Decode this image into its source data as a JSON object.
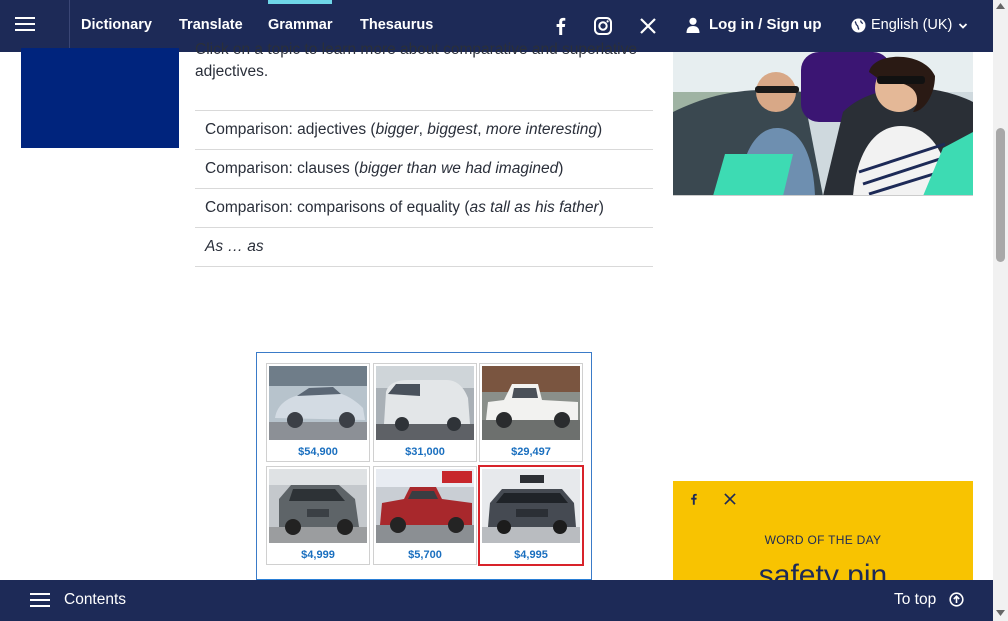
{
  "nav": {
    "items": [
      {
        "label": "Dictionary"
      },
      {
        "label": "Translate"
      },
      {
        "label": "Grammar",
        "active": true
      },
      {
        "label": "Thesaurus"
      }
    ],
    "login_label": "Log in / Sign up",
    "language_label": "English (UK)",
    "icons": [
      "menu-icon",
      "facebook-icon",
      "instagram-icon",
      "x-icon",
      "user-icon",
      "globe-icon",
      "chevron-down-icon"
    ]
  },
  "main": {
    "intro": "Click on a topic to learn more about comparative and superlative adjectives.",
    "topics": [
      {
        "prefix": "Comparison: adjectives (",
        "ex1": "bigger",
        "sep1": ", ",
        "ex2": "biggest",
        "sep2": ", ",
        "ex3": "more interesting",
        "suffix": ")"
      },
      {
        "prefix": "Comparison: clauses (",
        "ex1": "bigger than we had imagined",
        "suffix": ")"
      },
      {
        "prefix": "Comparison: comparisons of equality (",
        "ex1": "as tall as his father",
        "suffix": ")"
      },
      {
        "ex1": "As … as"
      }
    ]
  },
  "ad": {
    "prices": [
      "$54,900",
      "$31,000",
      "$29,497",
      "$4,999",
      "$5,700",
      "$4,995"
    ]
  },
  "sidebar": {
    "wotd_label": "WORD OF THE DAY",
    "wotd_word": "safety pin",
    "share_icons": [
      "facebook-icon",
      "x-icon"
    ]
  },
  "footer": {
    "contents_label": "Contents",
    "top_label": "To top"
  },
  "colors": {
    "navy": "#1d2a57",
    "accent_cyan": "#6fd6e8",
    "wotd_yellow": "#f8c301",
    "price_blue": "#1a6fbf"
  }
}
